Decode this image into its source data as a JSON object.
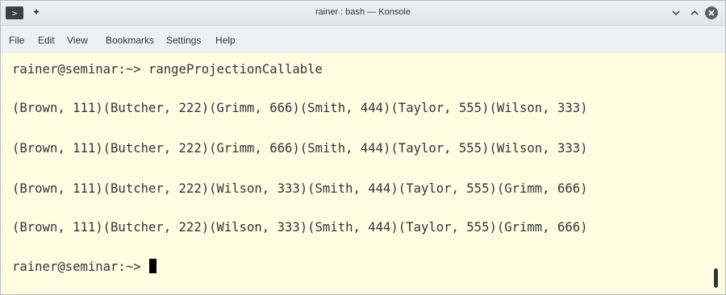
{
  "window": {
    "title": "rainer : bash — Konsole",
    "app_icon": "terminal-icon",
    "app_icon_glyph": ">",
    "pin_icon": "pin-icon",
    "pin_glyph": "✦",
    "controls": [
      "minimize-chevron-icon",
      "maximize-chevron-icon",
      "close-icon"
    ]
  },
  "menu": {
    "items": [
      "File",
      "Edit",
      "View",
      "Bookmarks",
      "Settings",
      "Help"
    ]
  },
  "terminal": {
    "prompt": "rainer@seminar:~> ",
    "command": "rangeProjectionCallable",
    "output": [
      "(Brown, 111)(Butcher, 222)(Grimm, 666)(Smith, 444)(Taylor, 555)(Wilson, 333)",
      "(Brown, 111)(Butcher, 222)(Grimm, 666)(Smith, 444)(Taylor, 555)(Wilson, 333)",
      "(Brown, 111)(Butcher, 222)(Wilson, 333)(Smith, 444)(Taylor, 555)(Grimm, 666)",
      "(Brown, 111)(Butcher, 222)(Wilson, 333)(Smith, 444)(Taylor, 555)(Grimm, 666)"
    ],
    "final_prompt": "rainer@seminar:~> "
  },
  "colors": {
    "terminal_background": "#fffde1",
    "terminal_text": "#31363b",
    "titlebar": "#eff0f1",
    "cursor": "#000000"
  }
}
